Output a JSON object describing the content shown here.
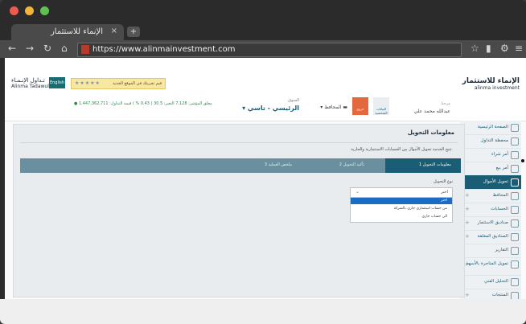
{
  "browser": {
    "tab_title": "الإنماء للاستثمار",
    "tab_close": "×",
    "url": "https://www.alinmainvestment.com"
  },
  "header": {
    "logo_right_ar": "الإنماء للاستثمار",
    "logo_right_en": "alinma investment",
    "logo_left_ar": "تـداول الإنـمـاء",
    "logo_left_en": "Alinma Tadawul",
    "english_btn": "English",
    "rating_stars": "★★★★★",
    "rating_msg": "قيم تجربتك في الموقع الجديد"
  },
  "strip": {
    "user_label": "مرحبا",
    "user_name": "عبدالله محمد علي",
    "btn_blue": "البيانات الشخصية",
    "btn_orange": "خروج",
    "wallets": "المحافظ",
    "market_label": "السوق",
    "market_value": "الرئيسي - تاسي",
    "index_text": "● مغلق  المؤشر: 7,128  التغير: 30.5 ( 0.43 % )  قيمة التداول: 1,447,362,711"
  },
  "sidebar": {
    "items": [
      {
        "label": "الصفحة الرئيسية"
      },
      {
        "label": "محفظة التداول"
      },
      {
        "label": "أمر شراء"
      },
      {
        "label": "أمر بيع"
      },
      {
        "label": "تحويل الأموال"
      },
      {
        "label": "المحافظ"
      },
      {
        "label": "الحسابات"
      },
      {
        "label": "صناديق الاستثمار"
      },
      {
        "label": "الصناديق المغلقة"
      },
      {
        "label": "التقارير"
      },
      {
        "label": "تمويل المتاجرة بالأسهم"
      },
      {
        "label": "التحليل الفني"
      },
      {
        "label": "المنتجات"
      }
    ]
  },
  "panel": {
    "title": "معلومات التحويل",
    "desc": "تتيح الخدمة تحويل الأموال بين الحسابات الاستثمارية والجارية.",
    "steps": [
      "1 معلومات التحويل",
      "2 تأكيد التحويل",
      "3 ملخص العملية"
    ],
    "form_label": "نوع التحويل",
    "select_value": "اختر",
    "options": [
      "اختر",
      "من حساب استثماري جاري بالشركة",
      "الى حساب جاري"
    ]
  }
}
